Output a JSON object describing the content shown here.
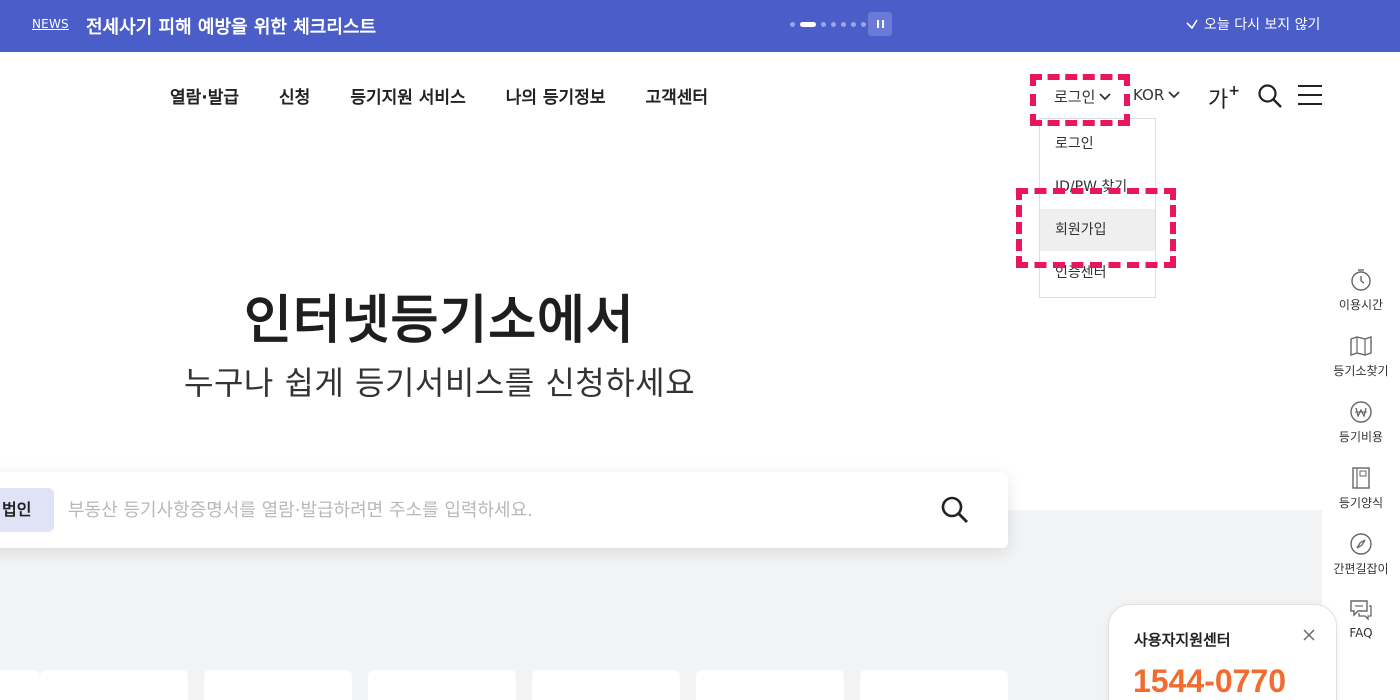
{
  "newsbar": {
    "tag": "NEWS",
    "headline": "전세사기 피해 예방을 위한 체크리스트",
    "no_show_label": "오늘 다시 보지 않기",
    "slide_count": 7,
    "active_slide": 2
  },
  "gnb": {
    "items": [
      "열람·발급",
      "신청",
      "등기지원 서비스",
      "나의 등기정보",
      "고객센터"
    ]
  },
  "utility": {
    "login_label": "로그인",
    "language_label": "KOR",
    "font_size_label": "가",
    "font_size_plus": "+"
  },
  "login_menu": {
    "items": [
      "로그인",
      "ID/PW 찾기",
      "회원가입",
      "인증센터"
    ],
    "highlighted_index": 2
  },
  "hero": {
    "title": "인터넷등기소에서",
    "subtitle": "누구나 쉽게 등기서비스를 신청하세요"
  },
  "search": {
    "category_chip": "법인",
    "placeholder": "부동산 등기사항증명서를 열람·발급하려면 주소를 입력하세요."
  },
  "quick_menu": {
    "items": [
      {
        "label": "이용시간",
        "icon": "clock-icon"
      },
      {
        "label": "등기소찾기",
        "icon": "map-icon"
      },
      {
        "label": "등기비용",
        "icon": "won-coin-icon"
      },
      {
        "label": "등기양식",
        "icon": "form-book-icon"
      },
      {
        "label": "간편길잡이",
        "icon": "compass-icon"
      },
      {
        "label": "FAQ",
        "icon": "faq-chat-icon"
      }
    ]
  },
  "support": {
    "title": "사용자지원센터",
    "phone": "1544-0770"
  },
  "colors": {
    "brand_blue": "#4a5dc9",
    "highlight_dash": "#e8175d",
    "phone_orange": "#f26b2f"
  }
}
